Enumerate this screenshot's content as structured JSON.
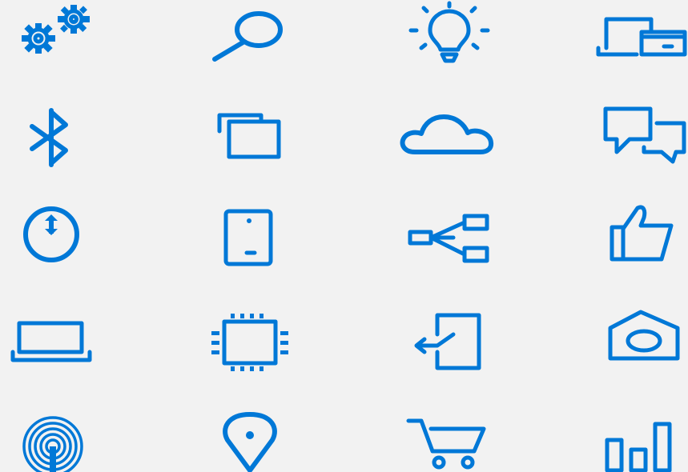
{
  "theme": {
    "accent_color": "#0078d7",
    "background_color": "#f2f2f2"
  },
  "icons": [
    [
      "gears-icon",
      "search-icon",
      "lightbulb-icon",
      "devices-icon"
    ],
    [
      "bluetooth-icon",
      "multitask-windows-icon",
      "cloud-icon",
      "chat-bubbles-icon"
    ],
    [
      "clock-sync-icon",
      "tablet-icon",
      "network-diagram-icon",
      "thumbs-up-icon"
    ],
    [
      "laptop-icon",
      "processor-chip-icon",
      "sign-in-icon",
      "camera-icon"
    ],
    [
      "wireless-signal-icon",
      "location-pin-icon",
      "shopping-cart-icon",
      "bar-chart-icon"
    ]
  ]
}
